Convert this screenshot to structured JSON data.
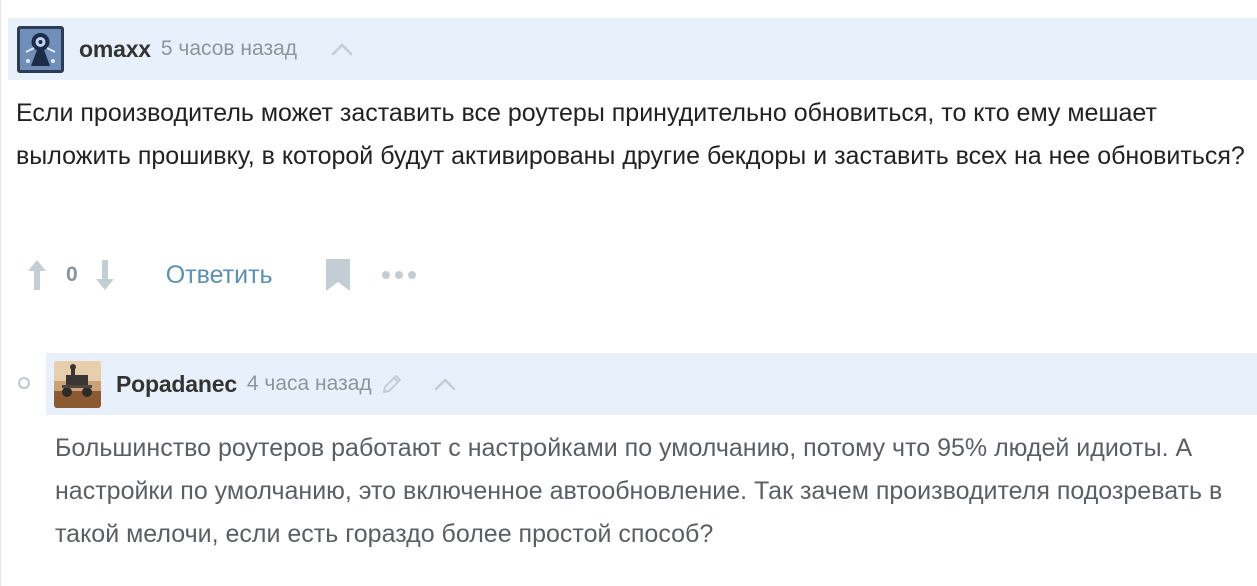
{
  "comments": [
    {
      "username": "omaxx",
      "time": "5 часов назад",
      "text": "Если производитель может заставить все роутеры принудительно обновиться, то кто ему мешает выложить прошивку, в которой будут активированы другие бекдоры и заставить всех на нее обновиться?",
      "votes": "0",
      "reply_label": "Ответить",
      "icons": [
        "avatar-omaxx",
        "up-arrow-icon",
        "upvote-icon",
        "downvote-icon",
        "bookmark-icon",
        "more-icon"
      ]
    },
    {
      "username": "Popadanec",
      "time": "4 часа назад",
      "text": "Большинство роутеров работают с настройками по умолчанию, потому что 95% людей идиоты. А настройки по умолчанию, это включенное автообновление. Так зачем производителя подозревать в такой мелочи, если есть гораздо более простой способ?",
      "icons": [
        "avatar-popadanec",
        "pencil-icon",
        "up-arrow-icon",
        "thread-dot-icon"
      ]
    }
  ],
  "colors": {
    "header_background": "#e8f1fb",
    "username": "#333333",
    "timestamp": "#8c949c",
    "reply_link": "#5e8fb0",
    "icons": "#c5cdd4",
    "body_text": "#222222",
    "reply_body_text": "#5b5f63"
  }
}
